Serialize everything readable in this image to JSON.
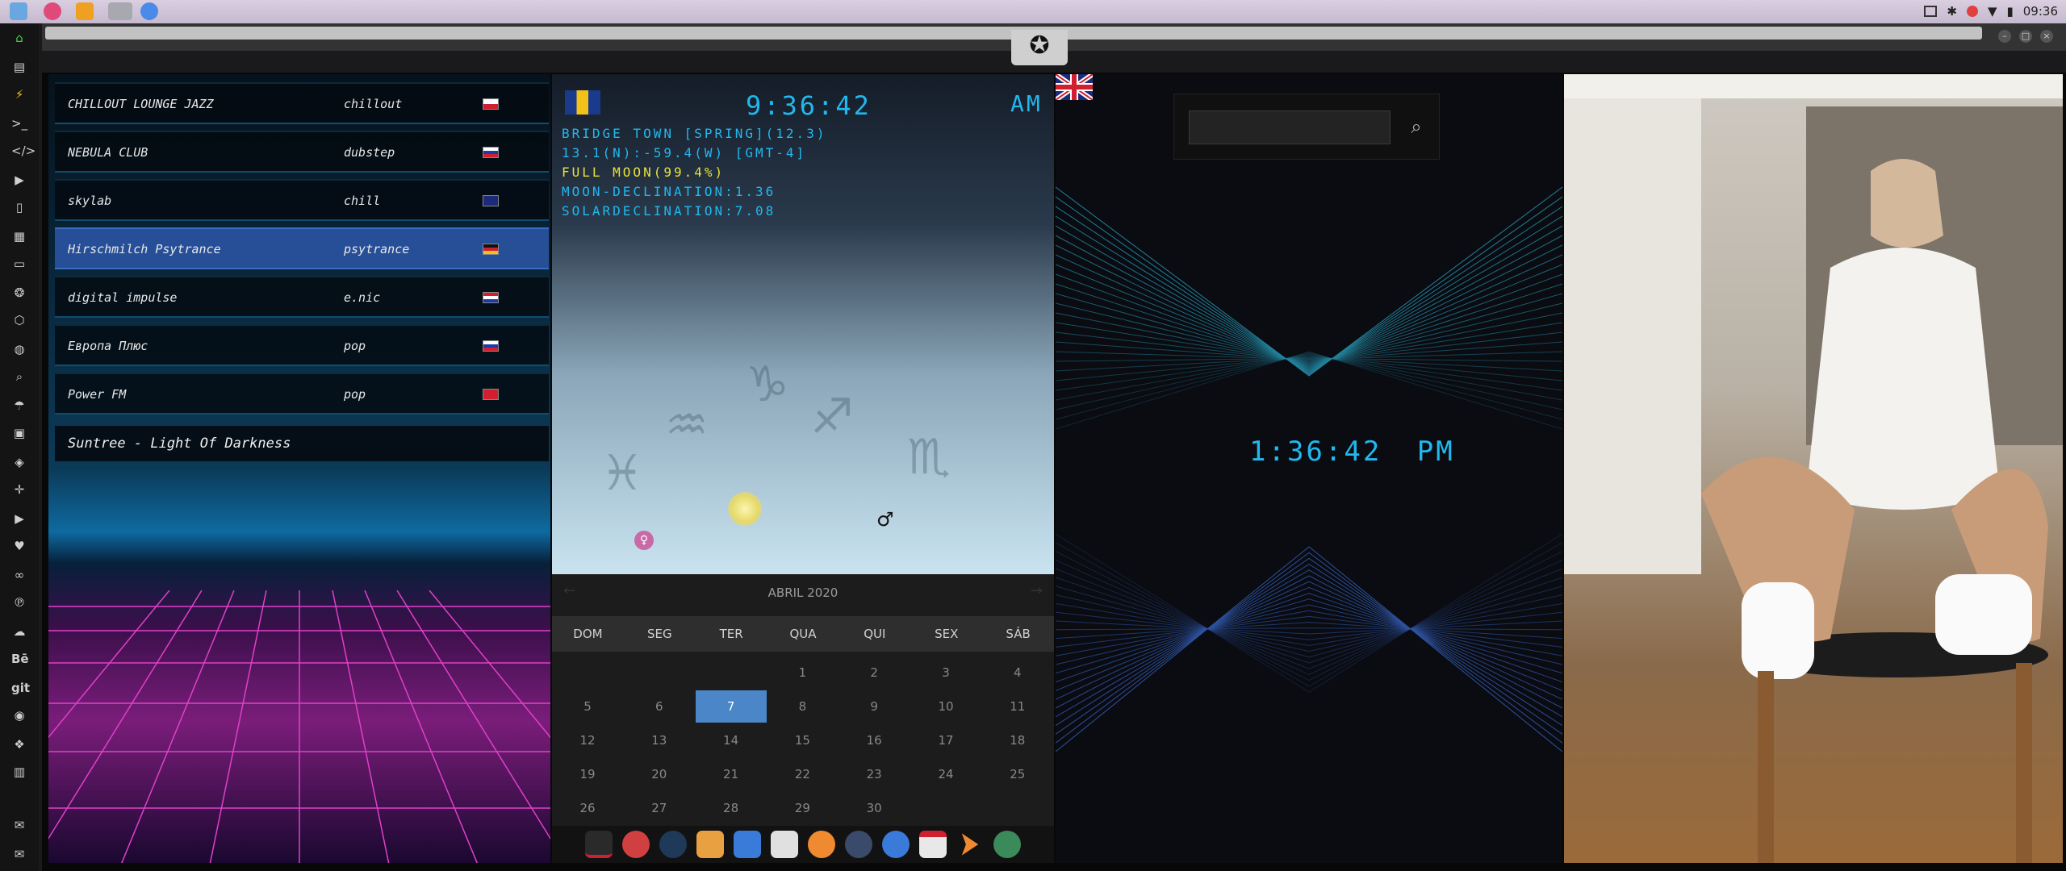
{
  "system": {
    "clock": "09:36"
  },
  "radio": {
    "stations": [
      {
        "name": "CHILLOUT LOUNGE JAZZ",
        "genre": "chillout",
        "flag": "poland-flag"
      },
      {
        "name": "NEBULA CLUB",
        "genre": "dubstep",
        "flag": "russia-flag"
      },
      {
        "name": "skylab",
        "genre": "chill",
        "flag": "uk-flag"
      },
      {
        "name": "Hirschmilch Psytrance",
        "genre": "psytrance",
        "flag": "germany-flag"
      },
      {
        "name": "digital impulse",
        "genre": "e.nic",
        "flag": "croatia-flag"
      },
      {
        "name": "Европа Плюс",
        "genre": "pop",
        "flag": "russia-flag"
      },
      {
        "name": "Power FM",
        "genre": "pop",
        "flag": "turkey-flag"
      }
    ],
    "now_playing": "Suntree - Light Of Darkness"
  },
  "astro": {
    "time": "9:36:42",
    "ampm": "AM",
    "city": "BRIDGE TOWN [SPRING](12.3)",
    "coords": "13.1(N):-59.4(W) [GMT-4]",
    "moon": "FULL MOON(99.4%)",
    "moon_decl": "MOON-DECLINATION:1.36",
    "solar_decl": "SOLARDECLINATION:7.08"
  },
  "calendar": {
    "title": "ABRIL 2020",
    "weekdays": [
      "DOM",
      "SEG",
      "TER",
      "QUA",
      "QUI",
      "SEX",
      "SÁB"
    ],
    "today": "7",
    "days": [
      [
        "",
        "",
        "",
        "1",
        "2",
        "3",
        "4"
      ],
      [
        "5",
        "6",
        "7",
        "8",
        "9",
        "10",
        "11"
      ],
      [
        "12",
        "13",
        "14",
        "15",
        "16",
        "17",
        "18"
      ],
      [
        "19",
        "20",
        "21",
        "22",
        "23",
        "24",
        "25"
      ],
      [
        "26",
        "27",
        "28",
        "29",
        "30",
        "",
        ""
      ]
    ]
  },
  "world_clock": {
    "time": "1:36:42",
    "ampm": "PM"
  },
  "colors": {
    "digital": "#22b8ee",
    "moon_text": "#e8e23a",
    "selected_row": "#274f98",
    "today": "#4a86c8"
  }
}
